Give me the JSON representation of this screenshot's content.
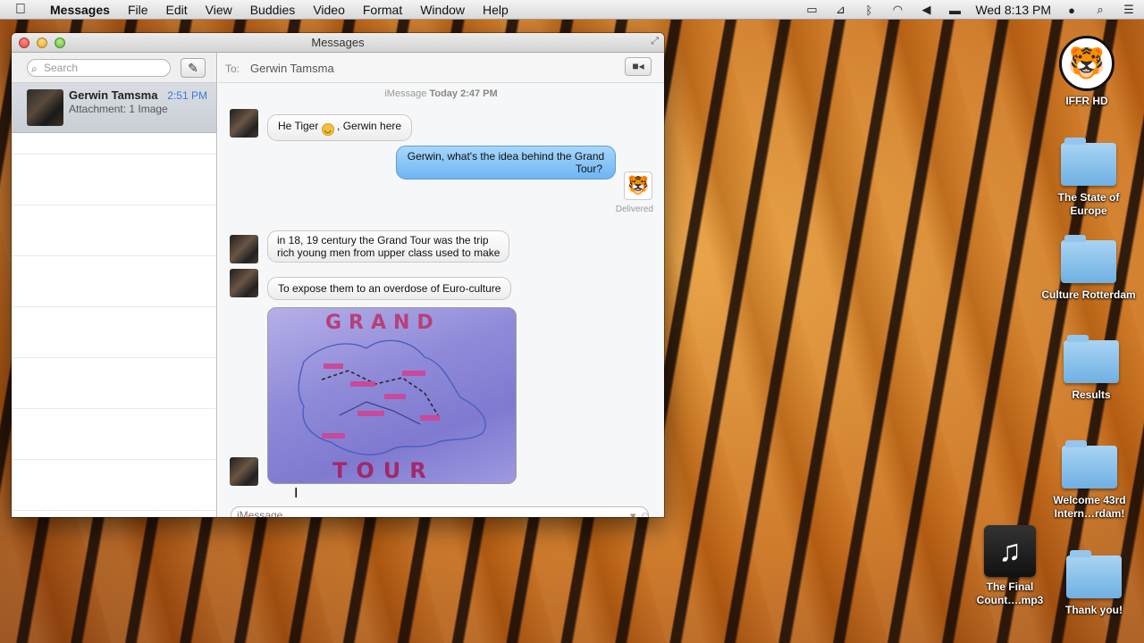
{
  "menubar": {
    "apple": "",
    "app_name": "Messages",
    "items": [
      "File",
      "Edit",
      "View",
      "Buddies",
      "Video",
      "Format",
      "Window",
      "Help"
    ],
    "clock": "Wed 8:13 PM",
    "status_icons": [
      "display-icon",
      "airplay-icon",
      "bluetooth-icon",
      "wifi-icon",
      "volume-icon",
      "battery-icon",
      "user-icon",
      "spotlight-icon",
      "notification-list-icon"
    ]
  },
  "window": {
    "title": "Messages"
  },
  "sidebar": {
    "search_placeholder": "Search",
    "conversations": [
      {
        "name": "Gerwin Tamsma",
        "time": "2:51 PM",
        "preview": "Attachment: 1 Image"
      }
    ]
  },
  "chat": {
    "to_label": "To:",
    "to_name": "Gerwin Tamsma",
    "timestamp_service": "iMessage",
    "timestamp_time": "Today 2:47 PM",
    "messages": [
      {
        "from": "in",
        "text_before": "He Tiger",
        "emoji": "😊",
        "text_after": ", Gerwin here"
      },
      {
        "from": "out",
        "line1": "Gerwin, what's the idea behind the Grand",
        "line2": "Tour?"
      },
      {
        "from": "in",
        "line1": "in 18, 19 century the Grand Tour was the trip",
        "line2": "rich young men from upper class used to make"
      },
      {
        "from": "in",
        "text": "To expose them to an overdose of Euro-culture"
      },
      {
        "from": "in",
        "image_caption_top": "GRAND",
        "image_caption_bottom": "TOUR"
      }
    ],
    "delivered": "Delivered",
    "input_placeholder": "iMessage"
  },
  "desktop": {
    "icons": [
      {
        "label": "IFFR HD"
      },
      {
        "label": "The State of Europe"
      },
      {
        "label": "Culture Rotterdam"
      },
      {
        "label": "Results"
      },
      {
        "label": "Welcome 43rd Intern…rdam!"
      },
      {
        "label": "The Final Count….mp3"
      },
      {
        "label": "Thank you!"
      }
    ]
  }
}
